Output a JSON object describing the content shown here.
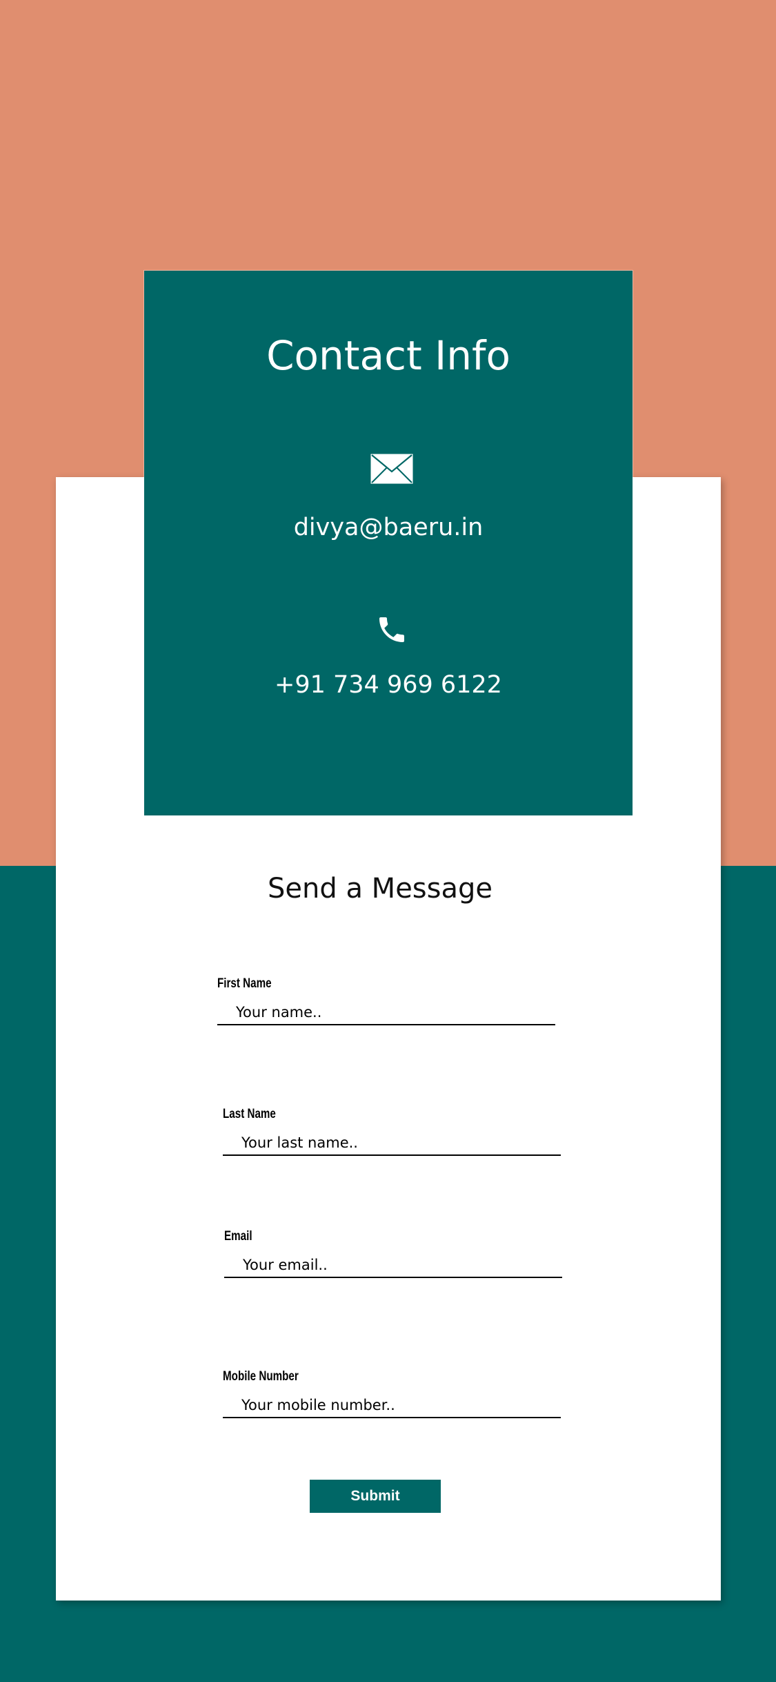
{
  "colors": {
    "peach": "#e08e6f",
    "teal": "#006766",
    "card": "#ffffff",
    "text": "#000000"
  },
  "contact_info": {
    "title": "Contact Info",
    "email_icon": "envelope-icon",
    "email": "divya@baeru.in",
    "phone_icon": "phone-icon",
    "phone": "+91 734 969 6122"
  },
  "form": {
    "title": "Send a Message",
    "fields": [
      {
        "label": "First Name",
        "placeholder": "Your name..",
        "value": ""
      },
      {
        "label": "Last Name",
        "placeholder": "Your last name..",
        "value": ""
      },
      {
        "label": "Email",
        "placeholder": "Your email..",
        "value": ""
      },
      {
        "label": "Mobile Number",
        "placeholder": "Your mobile number..",
        "value": ""
      }
    ],
    "submit_label": "Submit"
  }
}
